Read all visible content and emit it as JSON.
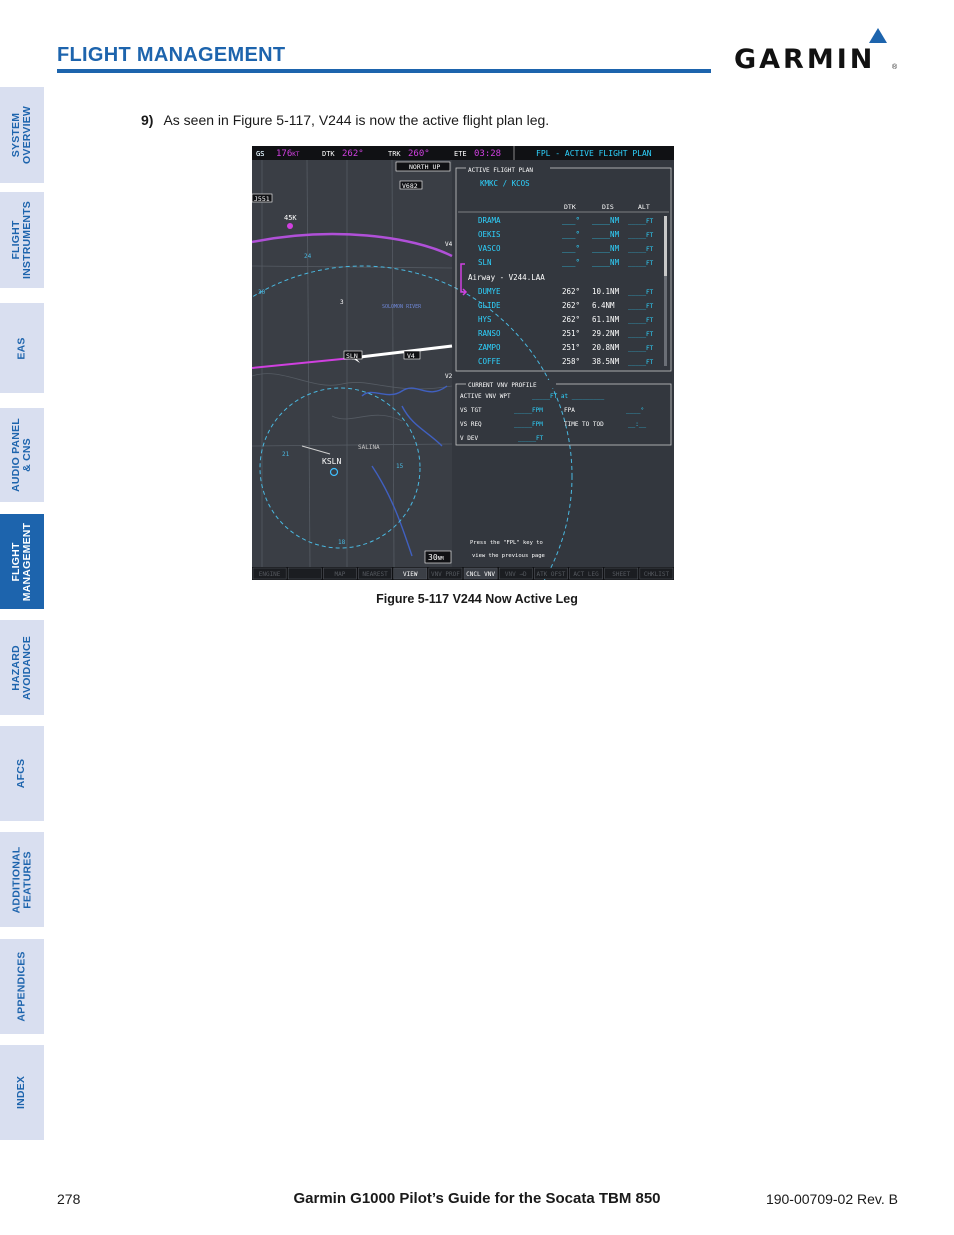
{
  "header": {
    "section_title": "FLIGHT MANAGEMENT",
    "brand": "GARMIN"
  },
  "sidebar": {
    "tabs": [
      {
        "label": "SYSTEM\nOVERVIEW",
        "active": false
      },
      {
        "label": "FLIGHT\nINSTRUMENTS",
        "active": false
      },
      {
        "label": "EAS",
        "active": false
      },
      {
        "label": "AUDIO PANEL\n& CNS",
        "active": false
      },
      {
        "label": "FLIGHT\nMANAGEMENT",
        "active": true
      },
      {
        "label": "HAZARD\nAVOIDANCE",
        "active": false
      },
      {
        "label": "AFCS",
        "active": false
      },
      {
        "label": "ADDITIONAL\nFEATURES",
        "active": false
      },
      {
        "label": "APPENDICES",
        "active": false
      },
      {
        "label": "INDEX",
        "active": false
      }
    ]
  },
  "body": {
    "step_number": "9)",
    "step_text": "As seen in Figure 5-117, V244 is now the active flight plan leg."
  },
  "figure": {
    "caption": "Figure 5-117  V244 Now Active Leg",
    "top_bar": {
      "gs_label": "GS",
      "gs_value": "176",
      "gs_unit": "KT",
      "dtk_label": "DTK",
      "dtk_value": "262°",
      "trk_label": "TRK",
      "trk_value": "260°",
      "ete_label": "ETE",
      "ete_value": "03:28",
      "page_title": "FPL - ACTIVE FLIGHT PLAN"
    },
    "map": {
      "orientation": "NORTH UP",
      "range": "30",
      "range_unit": "NM",
      "labels": [
        "V682",
        "J551",
        "45K",
        "SLN",
        "V4",
        "KSLN",
        "SALINA",
        "SOLOMON RIVER",
        "24",
        "30",
        "21",
        "15",
        "18",
        "3",
        "V4",
        "V2"
      ]
    },
    "fpl": {
      "box_title": "ACTIVE FLIGHT PLAN",
      "route": "KMKC / KCOS",
      "columns": [
        "DTK",
        "DIS",
        "ALT"
      ],
      "airway_label": "Airway - V244.LAA",
      "rows": [
        {
          "wpt": "DRAMA",
          "dtk": "___°",
          "dis": "____NM",
          "alt": "_____FT"
        },
        {
          "wpt": "OEKIS",
          "dtk": "___°",
          "dis": "____NM",
          "alt": "_____FT"
        },
        {
          "wpt": "VASCO",
          "dtk": "___°",
          "dis": "____NM",
          "alt": "_____FT"
        },
        {
          "wpt": "SLN",
          "dtk": "___°",
          "dis": "____NM",
          "alt": "_____FT"
        },
        {
          "wpt": "DUMYE",
          "dtk": "262°",
          "dis": "10.1NM",
          "alt": "_____FT"
        },
        {
          "wpt": "GLIDE",
          "dtk": "262°",
          "dis": "6.4NM",
          "alt": "_____FT"
        },
        {
          "wpt": "HYS",
          "dtk": "262°",
          "dis": "61.1NM",
          "alt": "_____FT"
        },
        {
          "wpt": "RANSO",
          "dtk": "251°",
          "dis": "29.2NM",
          "alt": "_____FT"
        },
        {
          "wpt": "ZAMPO",
          "dtk": "251°",
          "dis": "20.8NM",
          "alt": "_____FT"
        },
        {
          "wpt": "COFFE",
          "dtk": "258°",
          "dis": "38.5NM",
          "alt": "_____FT"
        }
      ]
    },
    "vnv": {
      "box_title": "CURRENT VNV PROFILE",
      "active_wpt_label": "ACTIVE VNV WPT",
      "active_wpt_value": "_____FT  at  _________",
      "vs_tgt_label": "VS TGT",
      "vs_tgt_value": "_____FPM",
      "fpa_label": "FPA",
      "fpa_value": "____°",
      "vs_req_label": "VS REQ",
      "vs_req_value": "_____FPM",
      "tod_label": "TIME TO TOD",
      "tod_value": "__:__",
      "vdev_label": "V DEV",
      "vdev_value": "_____FT"
    },
    "prompt": [
      "Press the \"FPL\" key to",
      "view the previous page"
    ],
    "softkeys": [
      "ENGINE",
      "",
      "MAP",
      "NEAREST",
      "VIEW",
      "VNV PROF",
      "CNCL VNV",
      "VNV →D",
      "ATK OFST",
      "ACT LEG",
      "SHEET",
      "CHKLIST"
    ]
  },
  "footer": {
    "page_number": "278",
    "title": "Garmin G1000 Pilot’s Guide for the Socata TBM 850",
    "doc_number": "190-00709-02  Rev. B"
  },
  "colors": {
    "brand_blue": "#1d64ad",
    "tab_bg": "#d9dff0",
    "display_cyan": "#2ed3ff",
    "display_magenta": "#d040e0"
  }
}
